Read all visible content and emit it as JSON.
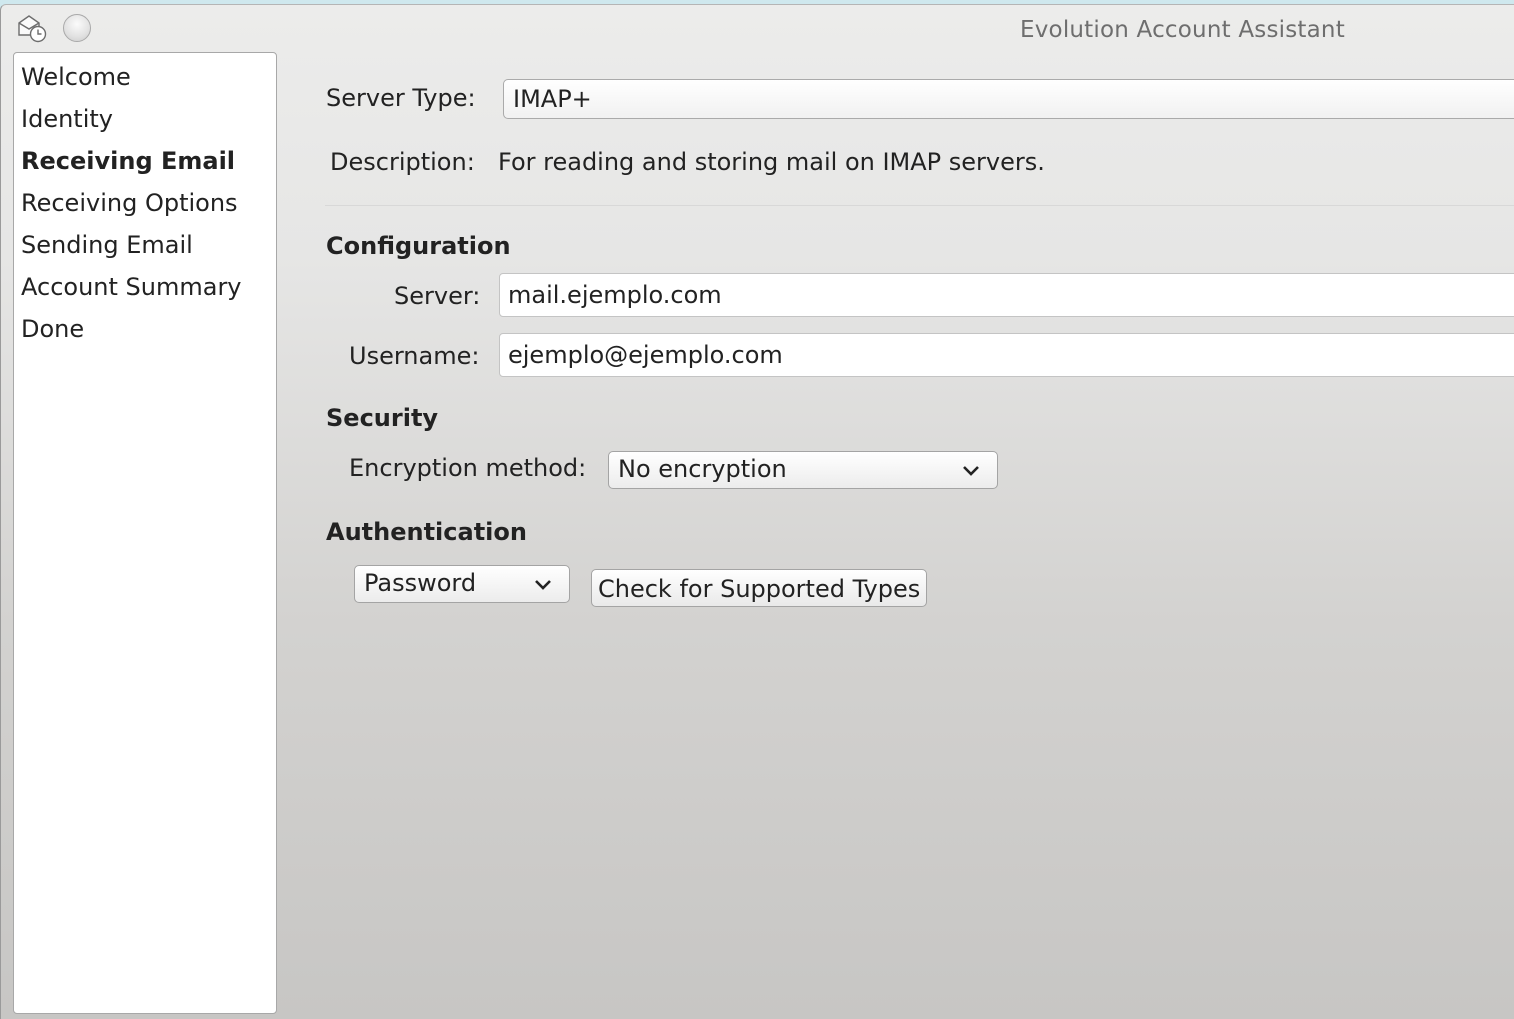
{
  "window": {
    "title": "Evolution Account Assistant"
  },
  "sidebar": {
    "steps": [
      {
        "label": "Welcome"
      },
      {
        "label": "Identity"
      },
      {
        "label": "Receiving Email",
        "active": true
      },
      {
        "label": "Receiving Options"
      },
      {
        "label": "Sending Email"
      },
      {
        "label": "Account Summary"
      },
      {
        "label": "Done"
      }
    ]
  },
  "form": {
    "server_type_label": "Server Type:",
    "server_type_value": "IMAP+",
    "description_label": "Description:",
    "description_value": "For reading and storing mail on IMAP servers.",
    "configuration_heading": "Configuration",
    "server_label": "Server:",
    "server_value": "mail.ejemplo.com",
    "username_label": "Username:",
    "username_value": "ejemplo@ejemplo.com",
    "security_heading": "Security",
    "encryption_label": "Encryption method:",
    "encryption_value": "No encryption",
    "authentication_heading": "Authentication",
    "auth_value": "Password",
    "check_types_button": "Check for Supported Types"
  },
  "icons": {
    "app": "evolution-mail-clock-icon",
    "minimize": "minimize-icon",
    "dropdown": "chevron-down-icon"
  }
}
